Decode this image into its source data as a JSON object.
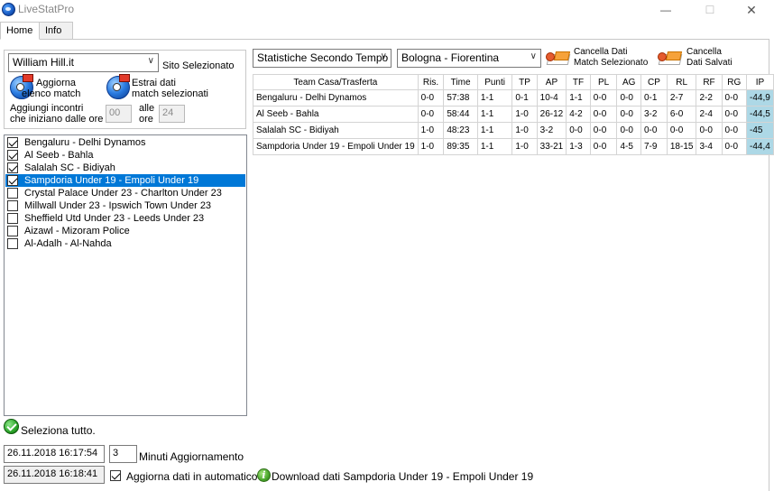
{
  "window": {
    "title": "LiveStatPro",
    "minimize_glyph": "—",
    "maximize_glyph": "☐",
    "close_glyph": "✕"
  },
  "tabs": [
    {
      "label": "Home",
      "active": true
    },
    {
      "label": "Info",
      "active": false
    }
  ],
  "site": {
    "selected": "William Hill.it",
    "label": "Sito Selezionato"
  },
  "actions": {
    "update_list": {
      "line1": "Aggiorna",
      "line2": "elenco match",
      "icon": "ball-refresh-icon"
    },
    "extract_data": {
      "line1": "Estrai dati",
      "line2": "match selezionati",
      "icon": "ball-extract-icon"
    }
  },
  "hours_filter": {
    "label_line1": "Aggiungi incontri",
    "label_line2": "che iniziano dalle ore",
    "from_value": "00",
    "to_label_line1": "alle",
    "to_label_line2": "ore",
    "to_value": "24"
  },
  "match_list": [
    {
      "name": "Bengaluru  - Delhi Dynamos",
      "checked": true,
      "selected": false
    },
    {
      "name": "Al Seeb  - Bahla",
      "checked": true,
      "selected": false
    },
    {
      "name": "Salalah SC  - Bidiyah",
      "checked": true,
      "selected": false
    },
    {
      "name": "Sampdoria Under 19  - Empoli Under 19",
      "checked": true,
      "selected": true
    },
    {
      "name": "Crystal Palace Under 23  - Charlton Under 23",
      "checked": false,
      "selected": false
    },
    {
      "name": "Millwall Under 23  - Ipswich Town Under 23",
      "checked": false,
      "selected": false
    },
    {
      "name": "Sheffield Utd Under 23  - Leeds Under 23",
      "checked": false,
      "selected": false
    },
    {
      "name": "Aizawl  - Mizoram Police",
      "checked": false,
      "selected": false
    },
    {
      "name": "Al-Adalh  - Al-Nahda",
      "checked": false,
      "selected": false
    }
  ],
  "stats_toolbar": {
    "stat_type": "Statistiche Secondo Tempo",
    "match": "Bologna - Fiorentina",
    "clear_selected": {
      "line1": "Cancella Dati",
      "line2": "Match Selezionato"
    },
    "clear_saved": {
      "line1": "Cancella",
      "line2": "Dati Salvati"
    }
  },
  "table": {
    "headers": [
      "Team Casa/Trasferta",
      "Ris.",
      "Time",
      "Punti",
      "TP",
      "AP",
      "TF",
      "PL",
      "AG",
      "CP",
      "RL",
      "RF",
      "RG",
      "IP"
    ],
    "rows": [
      [
        "Bengaluru - Delhi Dynamos",
        "0-0",
        "57:38",
        "1-1",
        "0-1",
        "10-4",
        "1-1",
        "0-0",
        "0-0",
        "0-1",
        "2-7",
        "2-2",
        "0-0",
        "-44,9"
      ],
      [
        "Al Seeb - Bahla",
        "0-0",
        "58:44",
        "1-1",
        "1-0",
        "26-12",
        "4-2",
        "0-0",
        "0-0",
        "3-2",
        "6-0",
        "2-4",
        "0-0",
        "-44,5"
      ],
      [
        "Salalah SC - Bidiyah",
        "1-0",
        "48:23",
        "1-1",
        "1-0",
        "3-2",
        "0-0",
        "0-0",
        "0-0",
        "0-0",
        "0-0",
        "0-0",
        "0-0",
        "-45"
      ],
      [
        "Sampdoria Under 19 - Empoli Under 19",
        "1-0",
        "89:35",
        "1-1",
        "1-0",
        "33-21",
        "1-3",
        "0-0",
        "4-5",
        "7-9",
        "18-15",
        "3-4",
        "0-0",
        "-44,4"
      ]
    ]
  },
  "bottom": {
    "select_all": "Seleziona tutto.",
    "datetime_1": "26.11.2018 16:17:54",
    "minutes_value": "3",
    "minutes_label": "Minuti Aggiornamento",
    "datetime_2": "26.11.2018 16:18:41",
    "auto_update_label": "Aggiorna dati  in automatico",
    "auto_update_checked": true,
    "download_status": "Download dati Sampdoria Under 19 - Empoli Under 19"
  },
  "colors": {
    "selection": "#0078d7",
    "ip_cell": "#add8e6"
  }
}
